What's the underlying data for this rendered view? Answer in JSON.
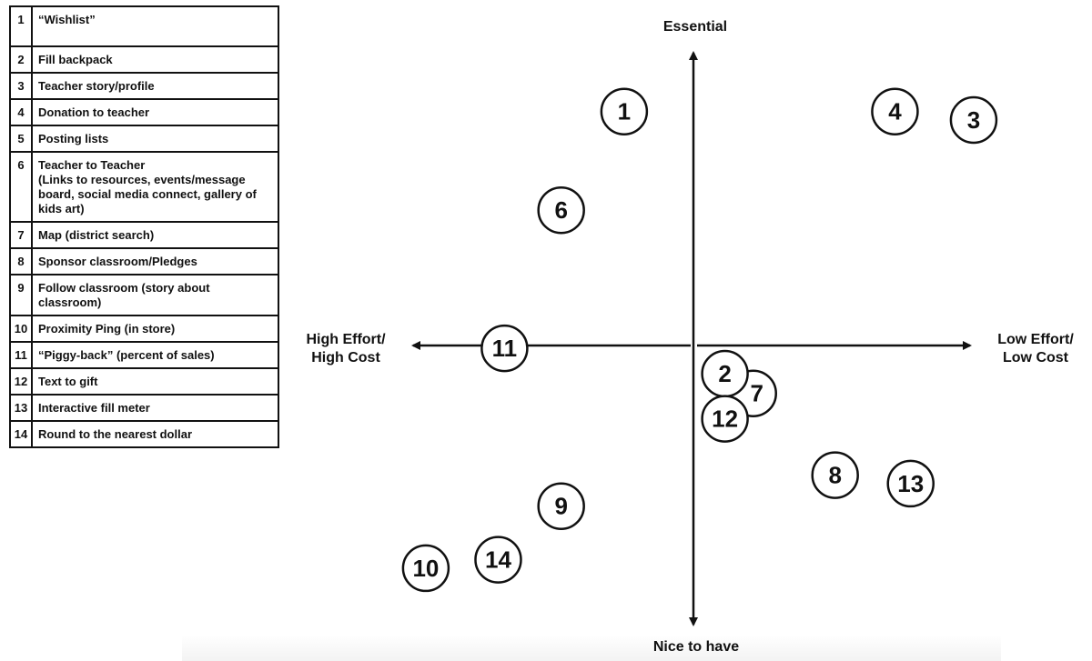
{
  "legend": [
    {
      "num": "1",
      "label": "“Wishlist”"
    },
    {
      "num": "2",
      "label": "Fill backpack"
    },
    {
      "num": "3",
      "label": "Teacher story/profile"
    },
    {
      "num": "4",
      "label": "Donation to teacher"
    },
    {
      "num": "5",
      "label": "Posting lists"
    },
    {
      "num": "6",
      "label": "Teacher to Teacher\n(Links to resources, events/message board, social media connect, gallery of kids art)"
    },
    {
      "num": "7",
      "label": "Map (district search)"
    },
    {
      "num": "8",
      "label": "Sponsor classroom/Pledges"
    },
    {
      "num": "9",
      "label": "Follow classroom (story about classroom)"
    },
    {
      "num": "10",
      "label": "Proximity Ping (in store)"
    },
    {
      "num": "11",
      "label": "“Piggy-back” (percent of sales)"
    },
    {
      "num": "12",
      "label": "Text to gift"
    },
    {
      "num": "13",
      "label": "Interactive fill meter"
    },
    {
      "num": "14",
      "label": "Round to the nearest dollar"
    }
  ],
  "axes": {
    "top": "Essential",
    "bottom": "Nice to have",
    "left": [
      "High Effort/",
      "High Cost"
    ],
    "right": [
      "Low Effort/",
      "Low Cost"
    ]
  },
  "chart_data": {
    "type": "scatter",
    "title": "",
    "xlabel_left": "High Effort/High Cost",
    "xlabel_right": "Low Effort/Low Cost",
    "ylabel_top": "Essential",
    "ylabel_bottom": "Nice to have",
    "xlim": [
      -1,
      1
    ],
    "ylim": [
      -1,
      1
    ],
    "points": [
      {
        "id": "1",
        "x": -0.22,
        "y": 0.83
      },
      {
        "id": "2",
        "x": 0.1,
        "y": -0.1
      },
      {
        "id": "3",
        "x": 0.89,
        "y": 0.8
      },
      {
        "id": "4",
        "x": 0.64,
        "y": 0.83
      },
      {
        "id": "6",
        "x": -0.42,
        "y": 0.48
      },
      {
        "id": "7",
        "x": 0.19,
        "y": -0.17
      },
      {
        "id": "8",
        "x": 0.45,
        "y": -0.46
      },
      {
        "id": "9",
        "x": -0.42,
        "y": -0.57
      },
      {
        "id": "10",
        "x": -0.85,
        "y": -0.79
      },
      {
        "id": "11",
        "x": -0.6,
        "y": -0.01
      },
      {
        "id": "12",
        "x": 0.1,
        "y": -0.26
      },
      {
        "id": "13",
        "x": 0.69,
        "y": -0.49
      },
      {
        "id": "14",
        "x": -0.62,
        "y": -0.76
      }
    ]
  }
}
